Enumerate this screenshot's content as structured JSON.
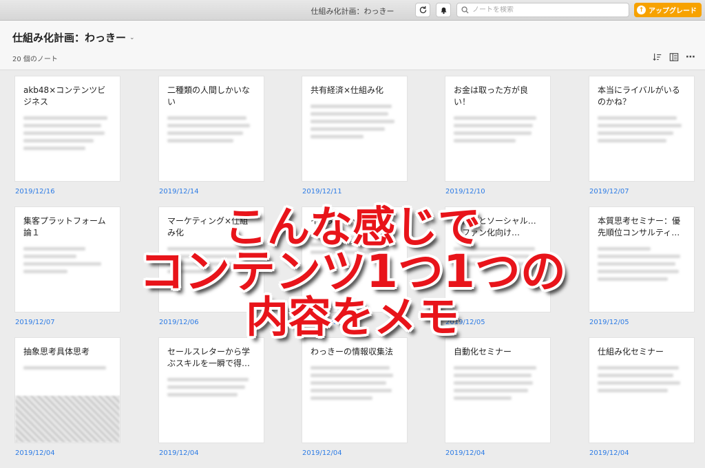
{
  "window": {
    "title": "仕組み化計画：わっきー"
  },
  "toolbar": {
    "sync_icon": "sync-icon",
    "bell_icon": "bell-icon",
    "search_placeholder": "ノートを検索",
    "upgrade_label": "アップグレード"
  },
  "notebook": {
    "title": "仕組み化計画：わっきー",
    "note_count": "20 個のノート"
  },
  "notes": [
    {
      "title": "akb48×コンテンツビジネス",
      "date": "2019/12/16"
    },
    {
      "title": "二種類の人間しかいない",
      "date": "2019/12/14"
    },
    {
      "title": "共有経済×仕組み化",
      "date": "2019/12/11"
    },
    {
      "title": "お金は取った方が良い！",
      "date": "2019/12/10"
    },
    {
      "title": "本当にライバルがいるのかね？",
      "date": "2019/12/07"
    },
    {
      "title": "集客プラットフォーム論１",
      "date": "2019/12/07"
    },
    {
      "title": "マーケティング×仕組み化",
      "date": "2019/12/06"
    },
    {
      "title": "インターネット…",
      "date": "2019/12/06"
    },
    {
      "title": "…向けとソーシャル…とファン化向け…",
      "date": "2019/12/05"
    },
    {
      "title": "本質思考セミナー：優先順位コンサルティ…",
      "date": "2019/12/05"
    },
    {
      "title": "抽象思考具体思考",
      "date": "2019/12/04"
    },
    {
      "title": "セールスレターから学ぶスキルを一瞬で得…",
      "date": "2019/12/04"
    },
    {
      "title": "わっきーの情報収集法",
      "date": "2019/12/04"
    },
    {
      "title": "自動化セミナー",
      "date": "2019/12/04"
    },
    {
      "title": "仕組み化セミナー",
      "date": "2019/12/04"
    }
  ],
  "overlay": {
    "line1": "こんな感じで",
    "line2": "コンテンツ1つ1つの",
    "line3": "内容をメモ"
  }
}
